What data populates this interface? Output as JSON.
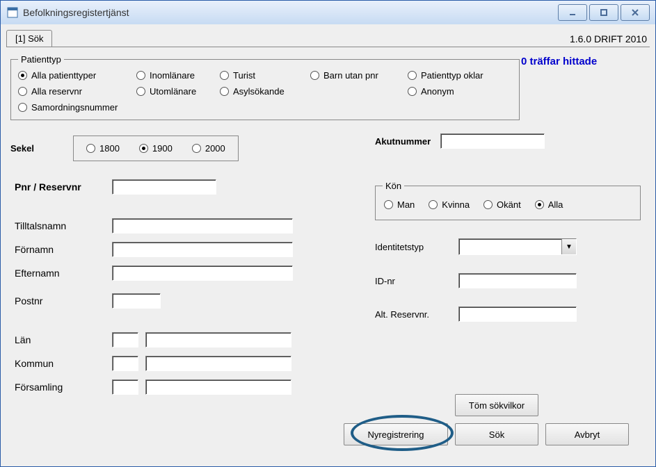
{
  "window": {
    "title": "Befolkningsregistertjänst"
  },
  "version": "1.6.0 DRIFT 2010",
  "tab": {
    "label": "[1] Sök"
  },
  "patienttyp": {
    "legend": "Patienttyp",
    "opts": {
      "alla_pt": "Alla patienttyper",
      "inom": "Inomlänare",
      "turist": "Turist",
      "barn": "Barn utan pnr",
      "oklar": "Patienttyp oklar",
      "alla_res": "Alla reservnr",
      "utom": "Utomlänare",
      "asyl": "Asylsökande",
      "anonym": "Anonym",
      "samord": "Samordningsnummer"
    }
  },
  "hits": "0 träffar hittade",
  "sekel": {
    "label": "Sekel",
    "y1800": "1800",
    "y1900": "1900",
    "y2000": "2000"
  },
  "akut": {
    "label": "Akutnummer",
    "value": ""
  },
  "pnr": {
    "label": "Pnr / Reservnr",
    "value": ""
  },
  "tilltal": {
    "label": "Tilltalsnamn",
    "value": ""
  },
  "fornamn": {
    "label": "Förnamn",
    "value": ""
  },
  "efternamn": {
    "label": "Efternamn",
    "value": ""
  },
  "postnr": {
    "label": "Postnr",
    "value": ""
  },
  "lan": {
    "label": "Län",
    "code": "",
    "name": ""
  },
  "kommun": {
    "label": "Kommun",
    "code": "",
    "name": ""
  },
  "forsamling": {
    "label": "Församling",
    "code": "",
    "name": ""
  },
  "kon": {
    "legend": "Kön",
    "man": "Man",
    "kvinna": "Kvinna",
    "okant": "Okänt",
    "alla": "Alla"
  },
  "idtyp": {
    "label": "Identitetstyp",
    "value": ""
  },
  "idnr": {
    "label": "ID-nr",
    "value": ""
  },
  "altres": {
    "label": "Alt. Reservnr.",
    "value": ""
  },
  "buttons": {
    "tom": "Töm sökvilkor",
    "nyreg": "Nyregistrering",
    "sok": "Sök",
    "avbryt": "Avbryt"
  }
}
